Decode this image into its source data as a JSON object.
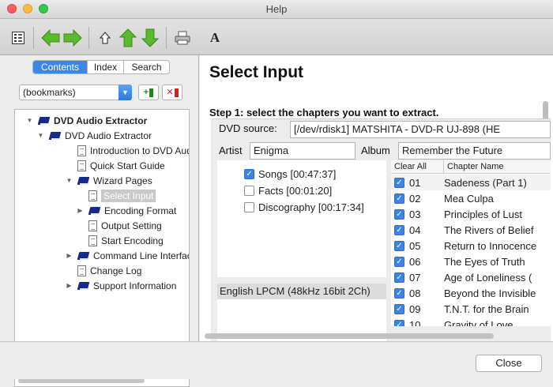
{
  "window": {
    "title": "Help"
  },
  "sidebar": {
    "tabs": [
      "Contents",
      "Index",
      "Search"
    ],
    "bookmarks_value": "(bookmarks)",
    "add_bookmark_label": "+",
    "remove_bookmark_label": "✕",
    "tree": [
      {
        "label": "DVD Audio Extractor",
        "type": "book",
        "level": 0,
        "disclosure": "open",
        "bold": true
      },
      {
        "label": "DVD Audio Extractor",
        "type": "book",
        "level": 1,
        "disclosure": "open"
      },
      {
        "label": "Introduction to DVD Audio",
        "type": "page",
        "level": 2
      },
      {
        "label": "Quick Start Guide",
        "type": "page",
        "level": 2
      },
      {
        "label": "Wizard Pages",
        "type": "book",
        "level": 2,
        "disclosure": "open"
      },
      {
        "label": "Select Input",
        "type": "page",
        "level": 3,
        "selected": true
      },
      {
        "label": "Encoding Format",
        "type": "book",
        "level": 3,
        "disclosure": "closed"
      },
      {
        "label": "Output Setting",
        "type": "page",
        "level": 3
      },
      {
        "label": "Start Encoding",
        "type": "page",
        "level": 3
      },
      {
        "label": "Command Line Interface",
        "type": "book",
        "level": 2,
        "disclosure": "closed"
      },
      {
        "label": "Change Log",
        "type": "page",
        "level": 2
      },
      {
        "label": "Support Information",
        "type": "book",
        "level": 2,
        "disclosure": "closed"
      }
    ]
  },
  "content": {
    "heading": "Select Input",
    "step": "Step 1: select the chapters you want to extract.",
    "dvd_source_label": "DVD source:",
    "dvd_source_value": "[/dev/rdisk1]  MATSHITA - DVD-R   UJ-898 (HE",
    "artist_label": "Artist",
    "artist_value": "Enigma",
    "album_label": "Album",
    "album_value": "Remember the Future",
    "titles": [
      {
        "label": "Songs [00:47:37]",
        "checked": true
      },
      {
        "label": "Facts [00:01:20]",
        "checked": false
      },
      {
        "label": "Discography [00:17:34]",
        "checked": false
      }
    ],
    "audio_stream": "English LPCM (48kHz 16bit 2Ch)",
    "chapter_headers": {
      "clear_all": "Clear All",
      "name": "Chapter Name"
    },
    "chapters": [
      {
        "num": "01",
        "name": "Sadeness (Part 1)"
      },
      {
        "num": "02",
        "name": "Mea Culpa"
      },
      {
        "num": "03",
        "name": "Principles of Lust"
      },
      {
        "num": "04",
        "name": "The Rivers of Belief"
      },
      {
        "num": "05",
        "name": "Return to Innocence"
      },
      {
        "num": "06",
        "name": "The Eyes of Truth"
      },
      {
        "num": "07",
        "name": "Age of Loneliness ("
      },
      {
        "num": "08",
        "name": "Beyond the Invisible"
      },
      {
        "num": "09",
        "name": "T.N.T. for the Brain"
      },
      {
        "num": "10",
        "name": "Gravity of Love"
      }
    ]
  },
  "footer": {
    "close_label": "Close"
  },
  "colors": {
    "accent": "#3d86e6",
    "book": "#142a8c",
    "arrow_green": "#5cb82e"
  },
  "toolbar_icons": [
    "toc-icon",
    "back-arrow-icon",
    "forward-arrow-icon",
    "home-icon",
    "up-arrow-icon",
    "down-arrow-icon",
    "print-icon",
    "font-icon"
  ]
}
